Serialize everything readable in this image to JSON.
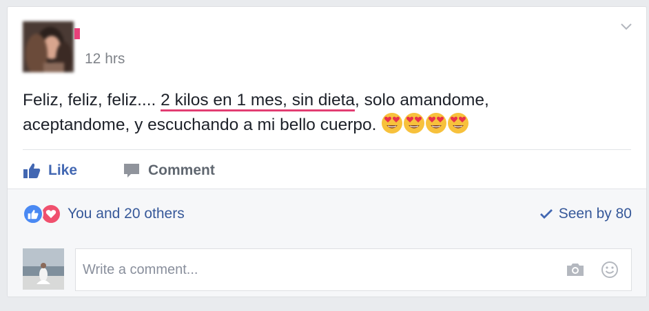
{
  "post": {
    "timestamp": "12 hrs",
    "text_before": "Feliz, feliz, feliz.... ",
    "text_highlight": "2 kilos en 1 mes, sin dieta",
    "text_after": ", solo amandome,",
    "text_line2": "aceptandome, y escuchando a mi bello cuerpo. ",
    "emoji_count": 4
  },
  "actions": {
    "like_label": "Like",
    "comment_label": "Comment"
  },
  "footer": {
    "reactions_text": "You and 20 others",
    "seen_text": "Seen by 80"
  },
  "comment": {
    "placeholder": "Write a comment..."
  },
  "colors": {
    "link_blue": "#365899",
    "like_blue": "#4267b2",
    "highlight_pink": "#e23d72",
    "love_red": "#f0506e"
  },
  "icons": [
    "chevron-down-icon",
    "like-thumb-icon",
    "comment-bubble-icon",
    "like-reaction-icon",
    "love-reaction-icon",
    "checkmark-icon",
    "camera-icon",
    "smiley-icon",
    "heart-eyes-emoji"
  ]
}
